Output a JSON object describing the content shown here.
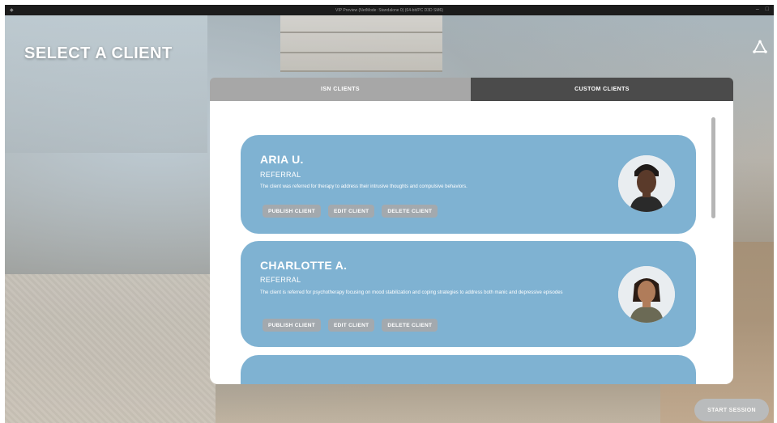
{
  "window": {
    "title": "VIP Preview (NetMode: Standalone 0) (64-bit/PC D3D SM6)",
    "controls": [
      "–",
      "□"
    ]
  },
  "screen": {
    "title": "SELECT A CLIENT",
    "brand_icon": "triangle-logo-icon"
  },
  "tabs": [
    {
      "label": "ISN CLIENTS",
      "active": false
    },
    {
      "label": "CUSTOM CLIENTS",
      "active": true
    }
  ],
  "clients": [
    {
      "name": "ARIA U.",
      "type": "REFERRAL",
      "description": "The client was referred for therapy to address their intrusive thoughts and compulsive behaviors.",
      "actions": [
        "PUBLISH CLIENT",
        "EDIT CLIENT",
        "DELETE CLIENT"
      ]
    },
    {
      "name": "CHARLOTTE A.",
      "type": "REFERRAL",
      "description": "The client is referred for psychotherapy focusing on mood stabilization and coping strategies to address both manic and depressive episodes",
      "actions": [
        "PUBLISH CLIENT",
        "EDIT CLIENT",
        "DELETE CLIENT"
      ]
    }
  ],
  "footer": {
    "start_label": "START SESSION"
  },
  "colors": {
    "card": "#7fb2d2",
    "tab_inactive": "#a7a7a7",
    "tab_active": "#4b4b4b",
    "pill": "#a3a9ae"
  }
}
